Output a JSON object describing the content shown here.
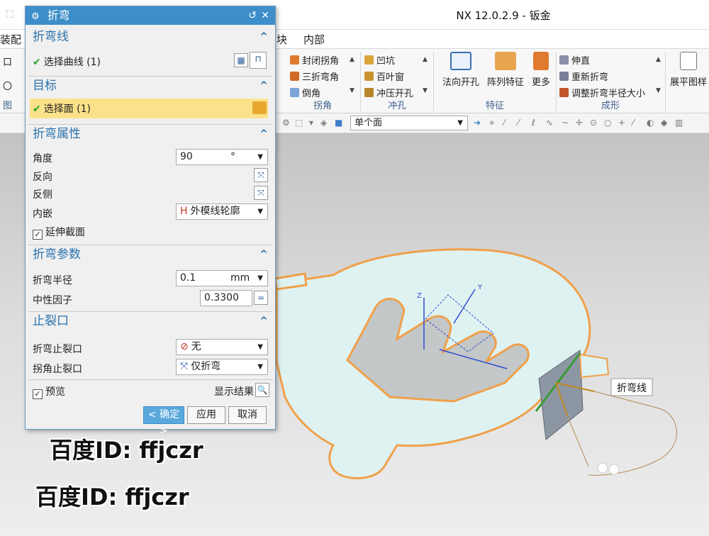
{
  "window": {
    "title": "NX 12.0.2.9 - 钣金"
  },
  "menubar": {
    "items": [
      "装配",
      "块",
      "内部"
    ]
  },
  "ribbon": {
    "left_edge": {
      "items": [
        "口",
        "〇"
      ],
      "group_label": "图"
    },
    "corner_group": {
      "items": [
        "封闭拐角",
        "三折弯角",
        "倒角"
      ],
      "label": "拐角"
    },
    "punch_group": {
      "items": [
        "凹坑",
        "百叶窗",
        "冲压开孔"
      ],
      "label": "冲孔"
    },
    "feature_group": {
      "buttons": [
        "法向开孔",
        "阵列特征",
        "更多"
      ],
      "label": "特征"
    },
    "form_group": {
      "items": [
        "伸直",
        "重新折弯",
        "调整折弯半径大小"
      ],
      "label": "成形"
    },
    "flat_group": {
      "button": "展平图样"
    },
    "colors": {
      "accent": "#3d8ec9",
      "group_label": "#3b5f8a"
    }
  },
  "selection_bar": {
    "filter": "单个面"
  },
  "dialog": {
    "title": "折弯",
    "bend_line": {
      "header": "折弯线",
      "select_curve": "选择曲线 (1)"
    },
    "target": {
      "header": "目标",
      "select_face": "选择面 (1)"
    },
    "bend_properties": {
      "header": "折弯属性",
      "angle_label": "角度",
      "angle_value": "90",
      "angle_unit": "°",
      "reverse_label": "反向",
      "reverse_side_label": "反侧",
      "inset_label": "内嵌",
      "inset_value": "外模线轮廓",
      "extend_section_label": "延伸截面",
      "extend_section_checked": true
    },
    "bend_params": {
      "header": "折弯参数",
      "radius_label": "折弯半径",
      "radius_value": "0.1",
      "radius_unit": "mm",
      "neutral_factor_label": "中性因子",
      "neutral_factor_value": "0.3300",
      "neutral_factor_op": "="
    },
    "relief": {
      "header": "止裂口",
      "bend_relief_label": "折弯止裂口",
      "bend_relief_value": "无",
      "corner_relief_label": "拐角止裂口",
      "corner_relief_value": "仅折弯"
    },
    "preview_label": "预览",
    "preview_checked": true,
    "show_result_label": "显示结果",
    "ok_label": "< 确定 >",
    "apply_label": "应用",
    "cancel_label": "取消"
  },
  "viewport": {
    "bend_line_tag": "折弯线",
    "axis_labels": [
      "Z",
      "Y"
    ],
    "colors": {
      "plate_fill": "#dff2f2",
      "plate_edge": "#f0a04a",
      "selection": "#2f4ccf"
    }
  },
  "watermarks": [
    "百度ID: ffjczr",
    "百度ID: ffjczr"
  ]
}
